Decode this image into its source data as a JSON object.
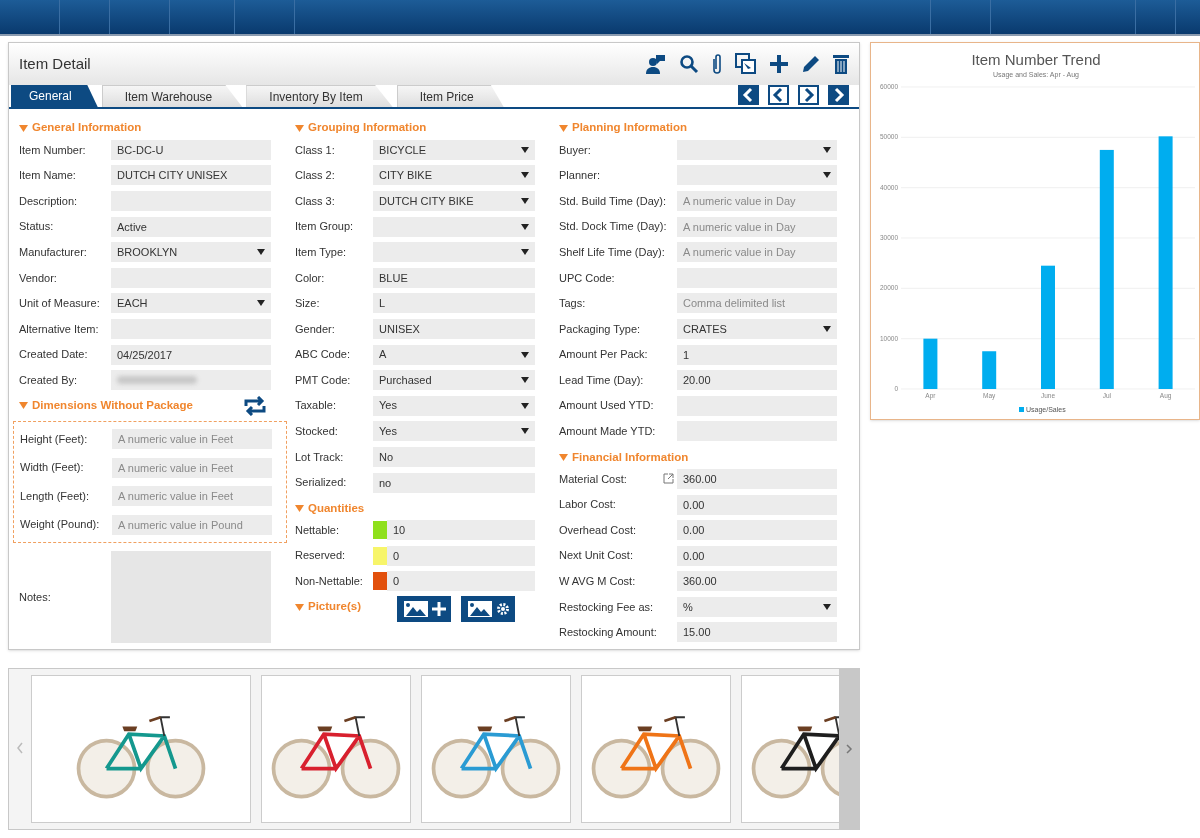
{
  "panel": {
    "title": "Item Detail"
  },
  "tabs": [
    {
      "label": "General",
      "selected": true
    },
    {
      "label": "Item Warehouse",
      "selected": false
    },
    {
      "label": "Inventory By Item",
      "selected": false
    },
    {
      "label": "Item Price",
      "selected": false
    }
  ],
  "columns": [
    {
      "sections": [
        {
          "title": "General Information",
          "fields": [
            {
              "label": "Item Number:",
              "kind": "text",
              "value": "BC-DC-U"
            },
            {
              "label": "Item Name:",
              "kind": "text",
              "value": "DUTCH CITY UNISEX"
            },
            {
              "label": "Description:",
              "kind": "text"
            },
            {
              "label": "Status:",
              "kind": "text",
              "value": "Active"
            },
            {
              "label": "Manufacturer:",
              "kind": "select",
              "value": "BROOKLYN"
            },
            {
              "label": "Vendor:",
              "kind": "text"
            },
            {
              "label": "Unit of Measure:",
              "kind": "select",
              "value": "EACH"
            },
            {
              "label": "Alternative Item:",
              "kind": "text"
            },
            {
              "label": "Created Date:",
              "kind": "text",
              "value": "04/25/2017"
            },
            {
              "label": "Created By:",
              "kind": "blurred"
            }
          ]
        },
        {
          "title": "Dimensions Without Package",
          "boxed": true,
          "fields": [
            {
              "label": "Height (Feet):",
              "kind": "text",
              "placeholder": "A numeric value in Feet"
            },
            {
              "label": "Width (Feet):",
              "kind": "text",
              "placeholder": "A numeric value in Feet"
            },
            {
              "label": "Length (Feet):",
              "kind": "text",
              "placeholder": "A numeric value in Feet"
            },
            {
              "label": "Weight (Pound):",
              "kind": "text",
              "placeholder": "A numeric value in Pound"
            }
          ]
        },
        {
          "fields": [
            {
              "label": "Notes:",
              "kind": "textarea"
            }
          ]
        }
      ]
    },
    {
      "sections": [
        {
          "title": "Grouping Information",
          "fields": [
            {
              "label": "Class 1:",
              "kind": "select",
              "value": "BICYCLE"
            },
            {
              "label": "Class 2:",
              "kind": "select",
              "value": "CITY BIKE"
            },
            {
              "label": "Class 3:",
              "kind": "select",
              "value": "DUTCH CITY BIKE"
            },
            {
              "label": "Item Group:",
              "kind": "select"
            },
            {
              "label": "Item Type:",
              "kind": "select"
            },
            {
              "label": "Color:",
              "kind": "text",
              "value": "BLUE"
            },
            {
              "label": "Size:",
              "kind": "text",
              "value": "L"
            },
            {
              "label": "Gender:",
              "kind": "text",
              "value": "UNISEX"
            },
            {
              "label": "ABC Code:",
              "kind": "select",
              "value": "A"
            },
            {
              "label": "PMT Code:",
              "kind": "select",
              "value": "Purchased"
            },
            {
              "label": "Taxable:",
              "kind": "select",
              "value": "Yes"
            },
            {
              "label": "Stocked:",
              "kind": "select",
              "value": "Yes"
            },
            {
              "label": "Lot Track:",
              "kind": "text",
              "value": "No"
            },
            {
              "label": "Serialized:",
              "kind": "text",
              "value": "no"
            }
          ]
        },
        {
          "title": "Quantities",
          "fields": [
            {
              "label": "Nettable:",
              "kind": "swatch",
              "color": "#8fe01c",
              "value": "10"
            },
            {
              "label": "Reserved:",
              "kind": "swatch",
              "color": "#f7f56a",
              "value": "0"
            },
            {
              "label": "Non-Nettable:",
              "kind": "swatch",
              "color": "#e2500c",
              "value": "0"
            }
          ]
        },
        {
          "title": "Picture(s)",
          "picture_buttons": true
        }
      ]
    },
    {
      "sections": [
        {
          "title": "Planning Information",
          "fields": [
            {
              "label": "Buyer:",
              "kind": "select"
            },
            {
              "label": "Planner:",
              "kind": "select"
            },
            {
              "label": "Std. Build Time (Day):",
              "kind": "text",
              "placeholder": "A numeric value in Day"
            },
            {
              "label": "Std. Dock Time (Day):",
              "kind": "text",
              "placeholder": "A numeric value in Day"
            },
            {
              "label": "Shelf Life Time (Day):",
              "kind": "text",
              "placeholder": "A numeric value in Day"
            },
            {
              "label": "UPC Code:",
              "kind": "text"
            },
            {
              "label": "Tags:",
              "kind": "text",
              "placeholder": "Comma delimited list"
            },
            {
              "label": "Packaging Type:",
              "kind": "select",
              "value": "CRATES"
            },
            {
              "label": "Amount Per Pack:",
              "kind": "text",
              "value": "1"
            },
            {
              "label": "Lead Time (Day):",
              "kind": "text",
              "value": "20.00"
            },
            {
              "label": "Amount Used YTD:",
              "kind": "text"
            },
            {
              "label": "Amount Made YTD:",
              "kind": "text"
            }
          ]
        },
        {
          "title": "Financial Information",
          "fields": [
            {
              "label": "Material Cost:",
              "kind": "linked",
              "value": "360.00"
            },
            {
              "label": "Labor Cost:",
              "kind": "text",
              "value": "0.00"
            },
            {
              "label": "Overhead Cost:",
              "kind": "text",
              "value": "0.00"
            },
            {
              "label": "Next Unit Cost:",
              "kind": "text",
              "value": "0.00"
            },
            {
              "label": "W AVG M Cost:",
              "kind": "text",
              "value": "360.00"
            },
            {
              "label": "Restocking Fee as:",
              "kind": "select",
              "value": "%"
            },
            {
              "label": "Restocking Amount:",
              "kind": "text",
              "value": "15.00"
            }
          ]
        }
      ]
    }
  ],
  "chart": {
    "chart_data": {
      "type": "bar",
      "title": "Item Number Trend",
      "subtitle": "Usage and Sales: Apr - Aug",
      "categories": [
        "Apr",
        "May",
        "June",
        "Jul",
        "Aug"
      ],
      "series": [
        {
          "name": "Usage/Sales",
          "color": "#00adef",
          "values": [
            10000,
            7500,
            24500,
            47500,
            50200
          ]
        }
      ],
      "ylim": [
        0,
        60000
      ],
      "grid": true,
      "yticks": [
        0,
        10000,
        20000,
        30000,
        40000,
        50000,
        60000
      ]
    }
  }
}
